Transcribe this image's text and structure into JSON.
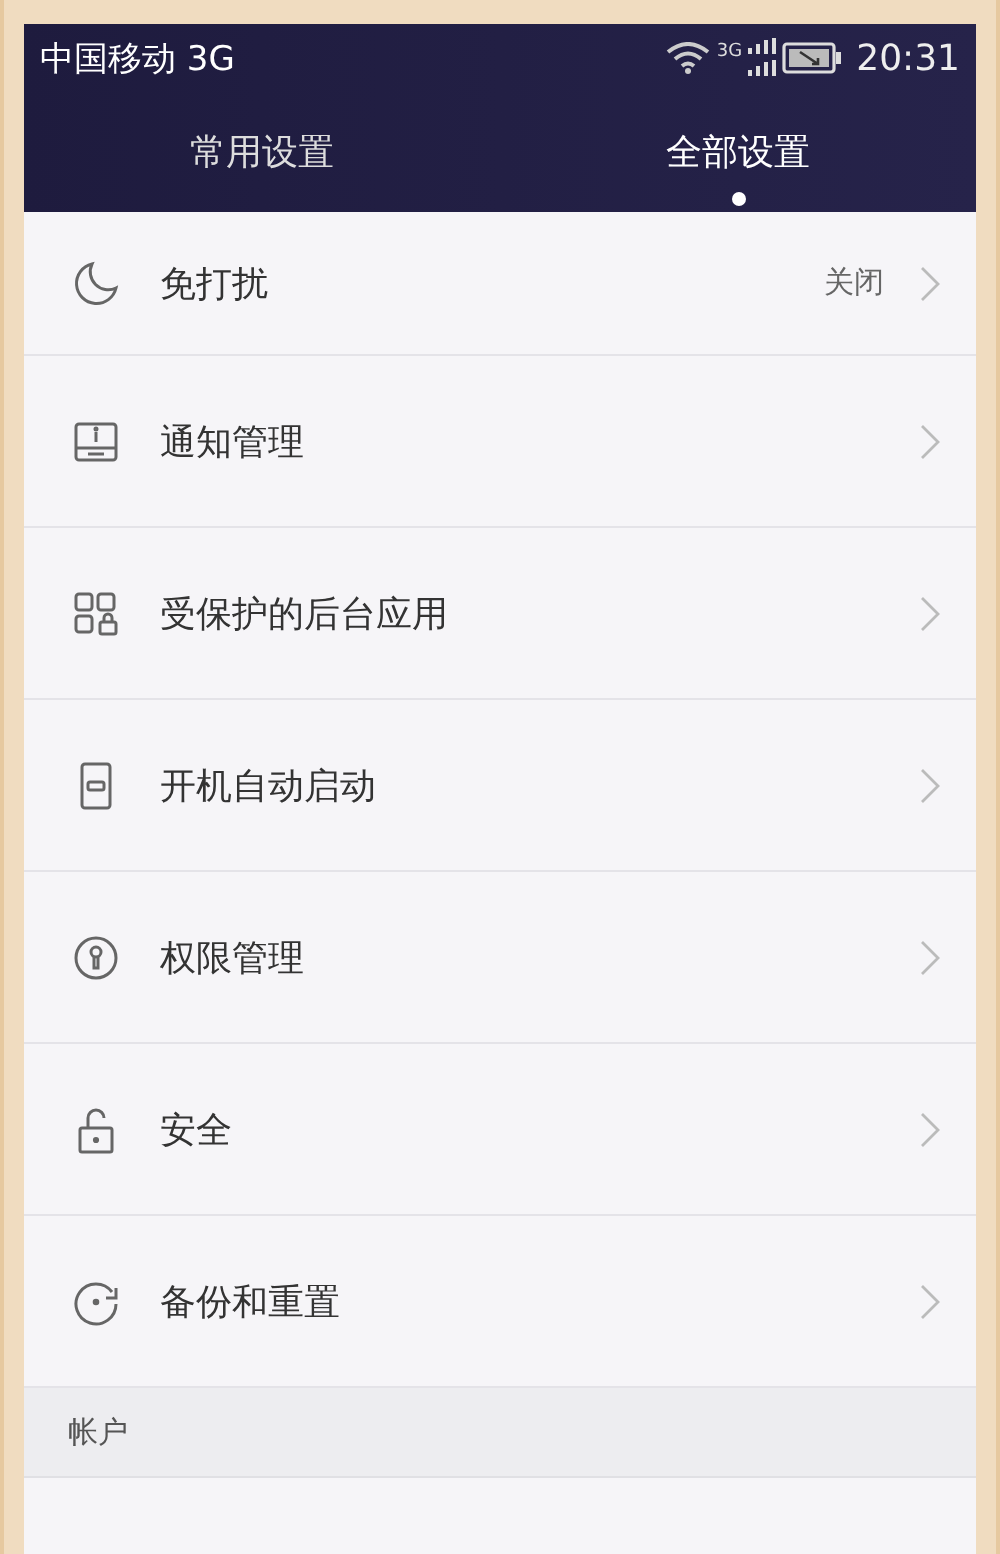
{
  "status_bar": {
    "carrier": "中国移动 3G",
    "network_label": "3G",
    "time": "20:31"
  },
  "tabs": [
    {
      "label": "常用设置",
      "selected": false
    },
    {
      "label": "全部设置",
      "selected": true
    }
  ],
  "items": [
    {
      "label": "免打扰",
      "value": "关闭"
    },
    {
      "label": "通知管理"
    },
    {
      "label": "受保护的后台应用"
    },
    {
      "label": "开机自动启动"
    },
    {
      "label": "权限管理"
    },
    {
      "label": "安全"
    },
    {
      "label": "备份和重置"
    }
  ],
  "section": {
    "title": "帐户"
  }
}
